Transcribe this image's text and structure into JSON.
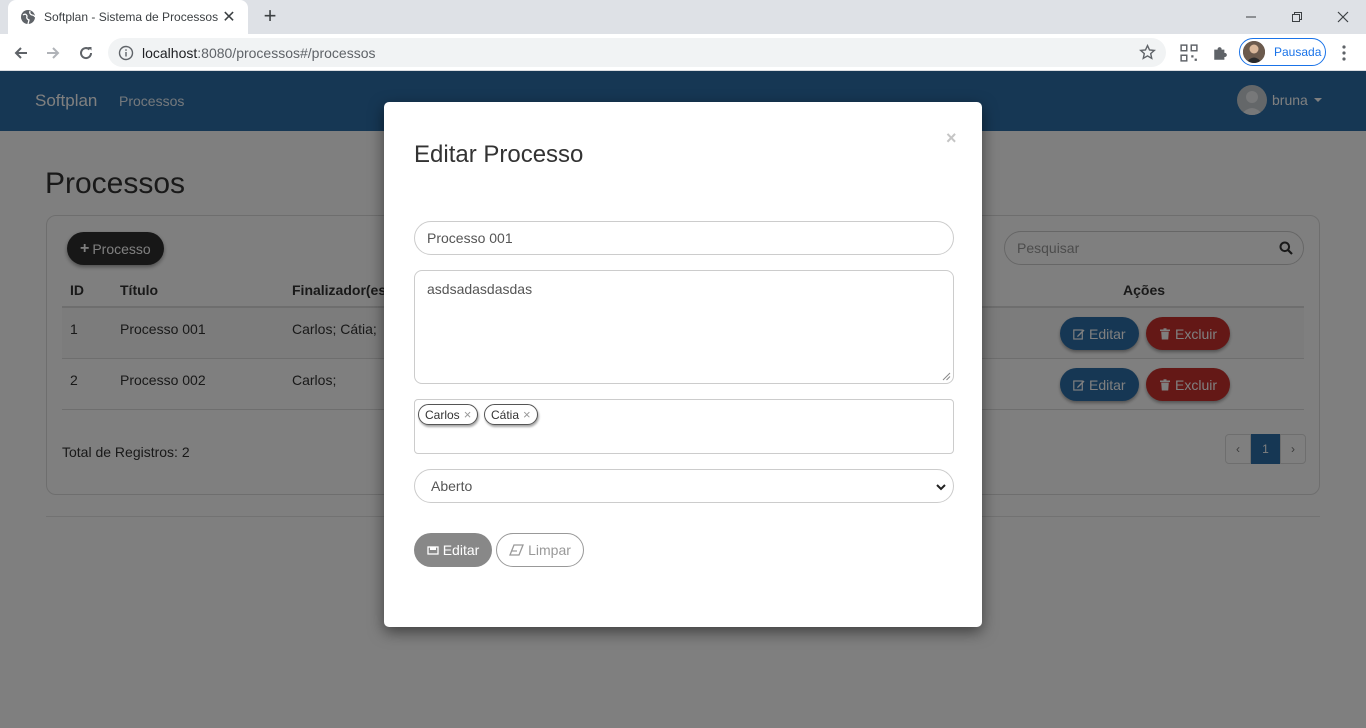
{
  "browser": {
    "tab_title": "Softplan - Sistema de Processos",
    "url_host": "localhost",
    "url_rest": ":8080/processos#/processos",
    "profile_label": "Pausada"
  },
  "navbar": {
    "brand": "Softplan",
    "link": "Processos",
    "user": "bruna"
  },
  "page": {
    "title": "Processos",
    "add_button": "Processo",
    "search_placeholder": "Pesquisar",
    "columns": [
      "ID",
      "Título",
      "Finalizador(es",
      "Ações"
    ],
    "rows": [
      {
        "id": "1",
        "titulo": "Processo 001",
        "finalizadores": "Carlos; Cátia;"
      },
      {
        "id": "2",
        "titulo": "Processo 002",
        "finalizadores": "Carlos;"
      }
    ],
    "edit_label": "Editar",
    "delete_label": "Excluir",
    "total_label": "Total de Registros: 2",
    "pager": {
      "prev": "‹",
      "current": "1",
      "next": "›"
    }
  },
  "modal": {
    "title": "Editar Processo",
    "close": "×",
    "titulo_value": "Processo 001",
    "descricao_value": "asdsadasdasdas",
    "tags": [
      "Carlos",
      "Cátia"
    ],
    "tag_remove": "×",
    "status_value": "Aberto",
    "save_label": "Editar",
    "clear_label": "Limpar"
  }
}
